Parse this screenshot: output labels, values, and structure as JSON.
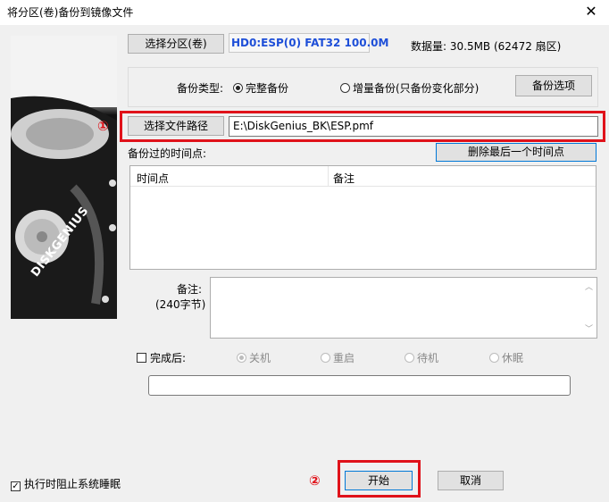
{
  "window": {
    "title": "将分区(卷)备份到镜像文件",
    "close_glyph": "✕"
  },
  "source": {
    "select_partition_label": "选择分区(卷)",
    "partition_info": "HD0:ESP(0) FAT32 100.0M",
    "data_size": "数据量: 30.5MB (62472 扇区)"
  },
  "backup_type": {
    "label": "备份类型:",
    "full_label": "完整备份",
    "incremental_label": "增量备份(只备份变化部分)",
    "options_label": "备份选项"
  },
  "file_path": {
    "button_label": "选择文件路径",
    "value": "E:\\DiskGenius_BK\\ESP.pmf",
    "marker": "①"
  },
  "timepoints": {
    "label": "备份过的时间点:",
    "delete_last_label": "删除最后一个时间点",
    "columns": [
      "时间点",
      "备注"
    ]
  },
  "note": {
    "label": "备注:",
    "hint": "(240字节)",
    "value": ""
  },
  "after_done": {
    "label": "完成后:",
    "options": [
      "关机",
      "重启",
      "待机",
      "休眠"
    ]
  },
  "prevent_sleep_label": "执行时阻止系统睡眠",
  "actions": {
    "start_label": "开始",
    "cancel_label": "取消",
    "marker": "②"
  },
  "brand": "DISKGENIUS",
  "colors": {
    "accent": "#0078d7",
    "highlight": "#e0121a",
    "partition_text": "#1e4fd8"
  }
}
